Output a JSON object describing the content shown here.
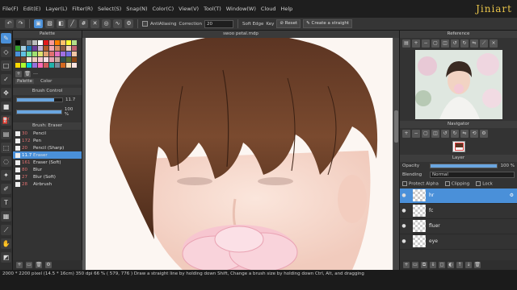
{
  "app": {
    "watermark": "Jiniart",
    "document_title": "swoo petal.mdp",
    "accent": "#4a90d9"
  },
  "menu": [
    "File(F)",
    "Edit(E)",
    "Layer(L)",
    "Filter(R)",
    "Select(S)",
    "Snap(N)",
    "Color(C)",
    "View(V)",
    "Tool(T)",
    "Window(W)",
    "Cloud",
    "Help"
  ],
  "toolbar": {
    "antialiasing_label": "AntiAliasing",
    "correction_label": "Correction",
    "correction_value": "20",
    "soft_edge_label": "Soft Edge",
    "key_label": "Key",
    "reset_label": "Reset",
    "create_straight_label": "Create a straight"
  },
  "left": {
    "palette_title": "Palette",
    "palette_tab": "Palette",
    "color_tab": "Color",
    "palette_dash": "---",
    "brush_control_title": "Brush Control",
    "size_value": "11.7",
    "opacity_value": "100 %",
    "size_fraction": 0.82,
    "opacity_fraction": 1.0,
    "brush_title": "Brush: Eraser",
    "brushes": [
      {
        "size": "30",
        "name": "Pencil"
      },
      {
        "size": "172",
        "name": "Pen"
      },
      {
        "size": "20",
        "name": "Pencil (Sharp)"
      },
      {
        "size": "11.7",
        "name": "Eraser"
      },
      {
        "size": "161",
        "name": "Eraser (Soft)"
      },
      {
        "size": "80",
        "name": "Blur"
      },
      {
        "size": "27",
        "name": "Blur (Soft)"
      },
      {
        "size": "28",
        "name": "Airbrush"
      }
    ]
  },
  "right": {
    "reference_title": "Reference",
    "navigator_title": "Navigator",
    "layer_title": "Layer",
    "opacity_label": "Opacity",
    "opacity_value": "100 %",
    "blending_label": "Blending",
    "blending_value": "Normal",
    "protect_alpha": "Protect Alpha",
    "clipping": "Clipping",
    "lock": "Lock",
    "layers": [
      {
        "name": "hr",
        "selected": true
      },
      {
        "name": "fc",
        "selected": false
      },
      {
        "name": "fluer",
        "selected": false
      },
      {
        "name": "eye",
        "selected": false
      }
    ]
  },
  "status": {
    "text": "2000 * 2200 pixel  (14.5 * 16cm)  350 dpi   66 %   ( 579, 776 )   Draw a straight line by holding down Shift, Change a brush size by holding down Ctrl, Alt, and dragging"
  }
}
